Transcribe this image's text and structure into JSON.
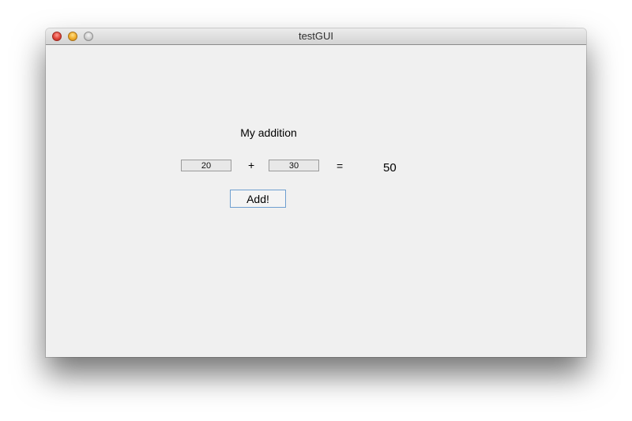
{
  "window": {
    "title": "testGUI"
  },
  "main": {
    "heading": "My addition",
    "operand_a": "20",
    "plus_sign": "+",
    "operand_b": "30",
    "equals_sign": "=",
    "result": "50",
    "add_button_label": "Add!"
  },
  "colors": {
    "window_background": "#f0f0f0",
    "button_focus_border": "#6e9fd0",
    "close_light": "#e0443a",
    "minimize_light": "#f0ad2a",
    "zoom_light": "#cfcfcf"
  }
}
